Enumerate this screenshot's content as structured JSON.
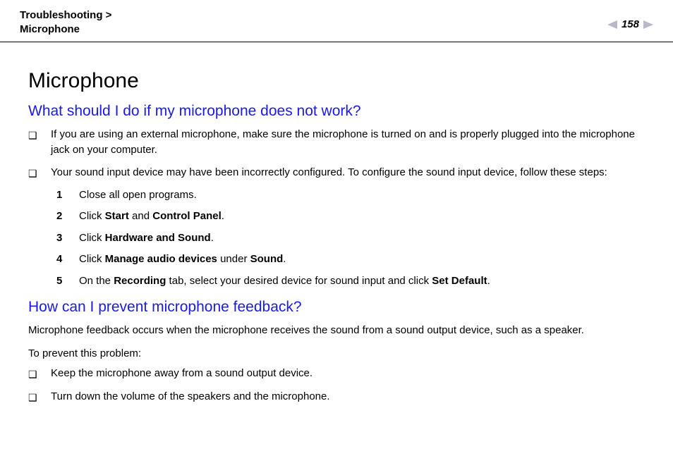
{
  "header": {
    "breadcrumb_section": "Troubleshooting",
    "breadcrumb_sep": ">",
    "breadcrumb_page": "Microphone",
    "page_number": "158"
  },
  "title": "Microphone",
  "q1": {
    "heading": "What should I do if my microphone does not work?",
    "bullets": [
      "If you are using an external microphone, make sure the microphone is turned on and is properly plugged into the microphone jack on your computer.",
      "Your sound input device may have been incorrectly configured. To configure the sound input device, follow these steps:"
    ],
    "steps_num": [
      "1",
      "2",
      "3",
      "4",
      "5"
    ],
    "steps": [
      {
        "pre": "Close all open programs.",
        "bold": [],
        "post": ""
      },
      {
        "pre": "Click ",
        "bold": [
          "Start"
        ],
        "mid": " and ",
        "bold2": [
          "Control Panel"
        ],
        "post": "."
      },
      {
        "pre": "Click ",
        "bold": [
          "Hardware and Sound"
        ],
        "post": "."
      },
      {
        "pre": "Click ",
        "bold": [
          "Manage audio devices"
        ],
        "mid": " under ",
        "bold2": [
          "Sound"
        ],
        "post": "."
      },
      {
        "pre": "On the ",
        "bold": [
          "Recording"
        ],
        "mid": " tab, select your desired device for sound input and click ",
        "bold2": [
          "Set Default"
        ],
        "post": "."
      }
    ]
  },
  "q2": {
    "heading": "How can I prevent microphone feedback?",
    "para1": "Microphone feedback occurs when the microphone receives the sound from a sound output device, such as a speaker.",
    "para2": "To prevent this problem:",
    "bullets": [
      "Keep the microphone away from a sound output device.",
      "Turn down the volume of the speakers and the microphone."
    ]
  }
}
